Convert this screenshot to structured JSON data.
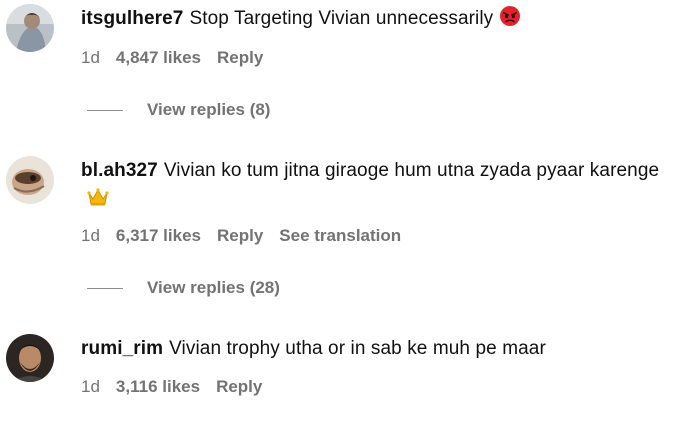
{
  "comments": [
    {
      "username": "itsgulhere7",
      "text": "Stop Targeting Vivian unnecessarily",
      "emoji": "angry-face",
      "time": "1d",
      "likes": "4,847 likes",
      "reply": "Reply",
      "view_replies": "View replies (8)"
    },
    {
      "username": "bl.ah327",
      "text": "Vivian ko tum jitna giraoge hum utna zyada pyaar karenge",
      "emoji": "crown",
      "time": "1d",
      "likes": "6,317 likes",
      "reply": "Reply",
      "translate": "See translation",
      "view_replies": "View replies (28)"
    },
    {
      "username": "rumi_rim",
      "text": "Vivian trophy utha or in sab ke muh pe maar",
      "time": "1d",
      "likes": "3,116 likes",
      "reply": "Reply"
    }
  ],
  "colors": {
    "text": "#111111",
    "muted": "#737373",
    "angry_emoji": "#e0242b",
    "crown_emoji": "#f5b70a"
  }
}
